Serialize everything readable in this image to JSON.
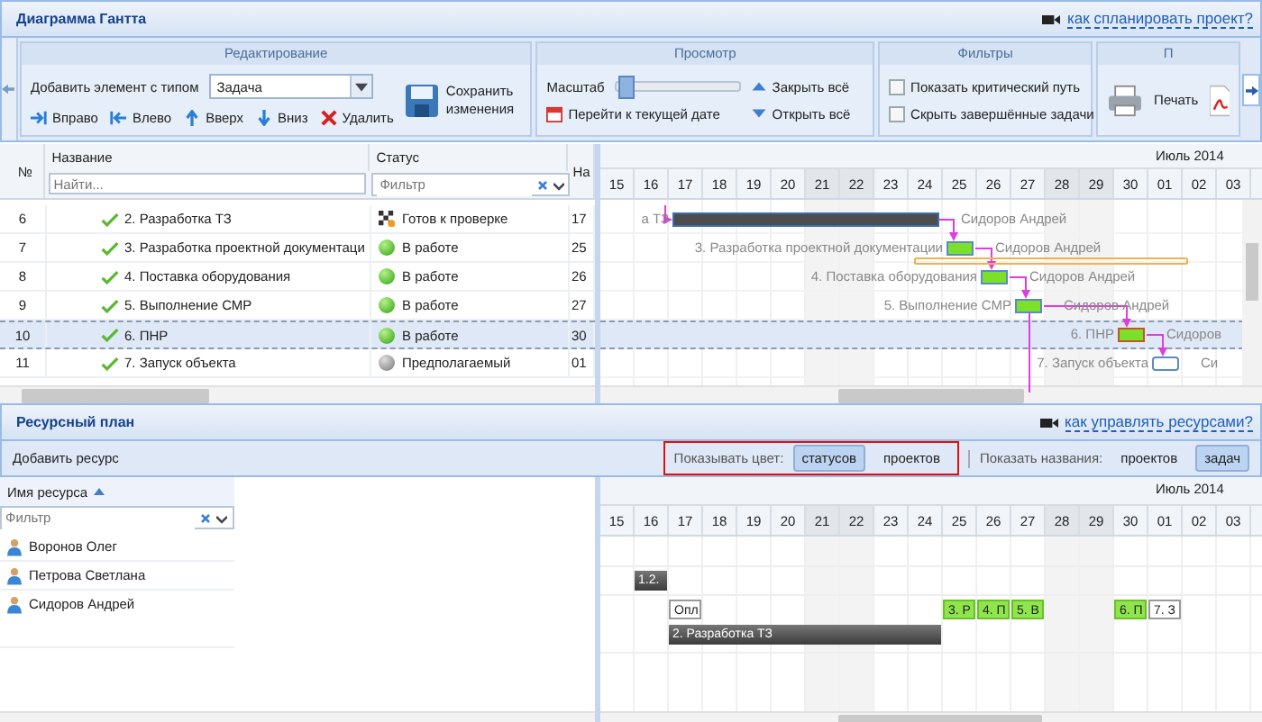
{
  "window": {
    "title": "Диаграмма Гантта",
    "help_link": "как спланировать проект?"
  },
  "editing": {
    "title": "Редактирование",
    "add_label": "Добавить элемент с типом",
    "add_type": "Задача",
    "save": "Сохранить изменения",
    "actions": [
      {
        "label": "Вправо",
        "kind": "right"
      },
      {
        "label": "Влево",
        "kind": "left"
      },
      {
        "label": "Вверх",
        "kind": "up"
      },
      {
        "label": "Вниз",
        "kind": "down"
      },
      {
        "label": "Удалить",
        "kind": "delete"
      }
    ]
  },
  "view": {
    "title": "Просмотр",
    "scale_label": "Масштаб",
    "scale": {
      "level": 0.02
    },
    "goto_today": "Перейти к текущей дате",
    "collapse_all": "Закрыть всё",
    "expand_all": "Открыть всё"
  },
  "filters": {
    "title": "Фильтры",
    "items": [
      {
        "label": "Показать критический путь",
        "checked": false
      },
      {
        "label": "Скрыть завершённые задачи",
        "checked": false
      }
    ]
  },
  "export": {
    "title": "П",
    "print": "Печать"
  },
  "tasks": {
    "columns": [
      "№",
      "Название",
      "Статус",
      "На"
    ],
    "search_placeholder": "Найти...",
    "status_placeholder": "Фильтр",
    "rows": [
      {
        "num": "6",
        "name": "2. Разработка ТЗ",
        "status": {
          "label": "Готов к проверке",
          "kind": "review"
        },
        "column_4": "17",
        "selected": false,
        "bar": {
          "kind": "summary",
          "left_label": "а ТЗ",
          "right_label": "Сидоров Андрей"
        }
      },
      {
        "num": "7",
        "name": "3. Разработка проектной документаци",
        "status": {
          "label": "В работе",
          "kind": "active"
        },
        "column_4": "25",
        "selected": false,
        "bar": {
          "kind": "task",
          "left_label": "3. Разработка проектной документации",
          "right_label": "Сидоров Андрей"
        }
      },
      {
        "num": "8",
        "name": "4. Поставка оборудования",
        "status": {
          "label": "В работе",
          "kind": "active"
        },
        "column_4": "26",
        "selected": false,
        "bar": {
          "kind": "task",
          "left_label": "4. Поставка оборудования",
          "right_label": "Сидоров Андрей"
        }
      },
      {
        "num": "9",
        "name": "5. Выполнение СМР",
        "status": {
          "label": "В работе",
          "kind": "active"
        },
        "column_4": "27",
        "selected": false,
        "bar": {
          "kind": "task",
          "left_label": "5. Выполнение СМР",
          "right_label": "Сидоров Андрей"
        }
      },
      {
        "num": "10",
        "name": "6. ПНР",
        "status": {
          "label": "В работе",
          "kind": "active"
        },
        "column_4": "30",
        "selected": true,
        "bar": {
          "kind": "task",
          "left_label": "6. ПНР",
          "right_label": "Сидоров"
        }
      },
      {
        "num": "11",
        "name": "7. Запуск объекта",
        "status": {
          "label": "Предполагаемый",
          "kind": "planned"
        },
        "column_4": "01",
        "selected": false,
        "bar": {
          "kind": "planned",
          "left_label": "7. Запуск объекта",
          "right_label": "Си"
        }
      }
    ]
  },
  "timeline": {
    "month": "Июль 2014",
    "days": [
      {
        "label": "15",
        "weekend": false
      },
      {
        "label": "16",
        "weekend": false
      },
      {
        "label": "17",
        "weekend": false
      },
      {
        "label": "18",
        "weekend": false
      },
      {
        "label": "19",
        "weekend": false
      },
      {
        "label": "20",
        "weekend": false
      },
      {
        "label": "21",
        "weekend": true
      },
      {
        "label": "22",
        "weekend": true
      },
      {
        "label": "23",
        "weekend": false
      },
      {
        "label": "24",
        "weekend": false
      },
      {
        "label": "25",
        "weekend": false
      },
      {
        "label": "26",
        "weekend": false
      },
      {
        "label": "27",
        "weekend": false
      },
      {
        "label": "28",
        "weekend": true
      },
      {
        "label": "29",
        "weekend": true
      },
      {
        "label": "30",
        "weekend": false
      },
      {
        "label": "01",
        "weekend": false
      },
      {
        "label": "02",
        "weekend": false
      },
      {
        "label": "03",
        "weekend": false
      }
    ]
  },
  "resources": {
    "title": "Ресурсный план",
    "help_link": "как управлять ресурсами?",
    "add": "Добавить ресурс",
    "color_label": "Показывать цвет:",
    "color_options": [
      {
        "label": "статусов",
        "selected": true
      },
      {
        "label": "проектов",
        "selected": false
      }
    ],
    "names_label": "Показать названия:",
    "name_options": [
      {
        "label": "проектов",
        "selected": false
      },
      {
        "label": "задач",
        "selected": true
      }
    ],
    "column": "Имя ресурса",
    "filter_placeholder": "Фильтр",
    "rows": [
      {
        "name": "Воронов Олег",
        "chips": []
      },
      {
        "name": "Петрова Светлана",
        "chips": [
          {
            "label": "1.2.",
            "kind": "summary"
          }
        ]
      },
      {
        "name": "Сидоров Андрей",
        "chips": [
          {
            "label": "Опл",
            "kind": "planned"
          },
          {
            "label": "3. Р",
            "kind": "task"
          },
          {
            "label": "4. П",
            "kind": "task"
          },
          {
            "label": "5. В",
            "kind": "task"
          },
          {
            "label": "6. П",
            "kind": "task"
          },
          {
            "label": "7. З",
            "kind": "planned"
          },
          {
            "label": "2. Разработка ТЗ",
            "kind": "summary"
          }
        ]
      }
    ],
    "timeline": {
      "month": "Июль 2014",
      "days": [
        {
          "label": "15",
          "weekend": false
        },
        {
          "label": "16",
          "weekend": false
        },
        {
          "label": "17",
          "weekend": false
        },
        {
          "label": "18",
          "weekend": false
        },
        {
          "label": "19",
          "weekend": false
        },
        {
          "label": "20",
          "weekend": false
        },
        {
          "label": "21",
          "weekend": true
        },
        {
          "label": "22",
          "weekend": true
        },
        {
          "label": "23",
          "weekend": false
        },
        {
          "label": "24",
          "weekend": false
        },
        {
          "label": "25",
          "weekend": false
        },
        {
          "label": "26",
          "weekend": false
        },
        {
          "label": "27",
          "weekend": false
        },
        {
          "label": "28",
          "weekend": true
        },
        {
          "label": "29",
          "weekend": true
        },
        {
          "label": "30",
          "weekend": false
        },
        {
          "label": "01",
          "weekend": false
        },
        {
          "label": "02",
          "weekend": false
        },
        {
          "label": "03",
          "weekend": false
        }
      ]
    }
  }
}
